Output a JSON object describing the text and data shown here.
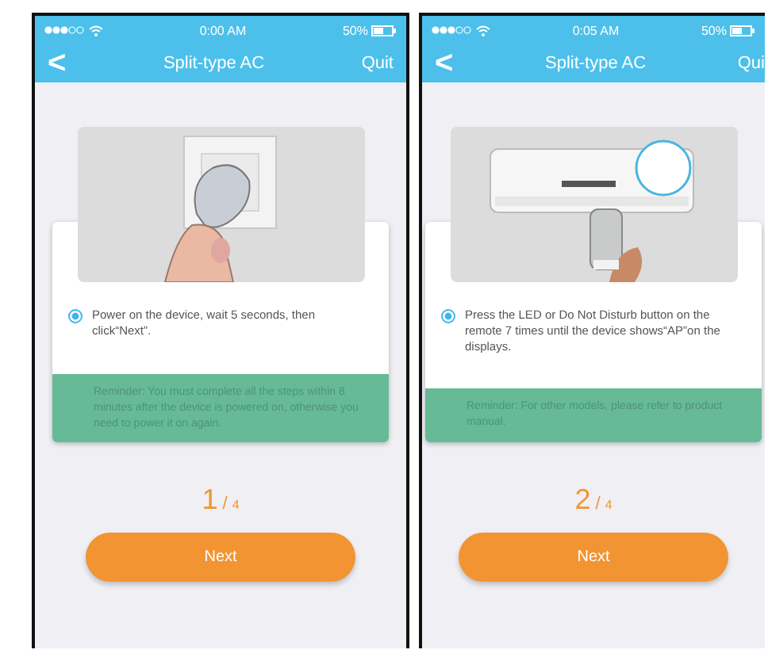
{
  "phones": [
    {
      "status_bar": {
        "time": "0:00 AM",
        "battery": "50%"
      },
      "nav": {
        "back": "<",
        "title": "Split-type AC",
        "action": "Quit"
      },
      "option": {
        "text": "Power on the device, wait 5 seconds, then click“Next”.",
        "selected": true
      },
      "reminder": "Reminder: You must complete all the steps within 8 minutes after the device is powered on, otherwise you need to power it on again.",
      "step": {
        "current": "1",
        "separator": "/",
        "total": "4"
      },
      "button": "Next"
    },
    {
      "status_bar": {
        "time": "0:05 AM",
        "battery": "50%"
      },
      "nav": {
        "back": "<",
        "title": "Split-type AC",
        "action": "Qui"
      },
      "option": {
        "text": "Press the LED or Do Not Disturb button on the remote 7 times until the device shows“AP”on the displays.",
        "selected": true
      },
      "reminder": "Reminder: For other models, please refer to product manual.",
      "step": {
        "current": "2",
        "separator": "/",
        "total": "4"
      },
      "button": "Next"
    }
  ]
}
